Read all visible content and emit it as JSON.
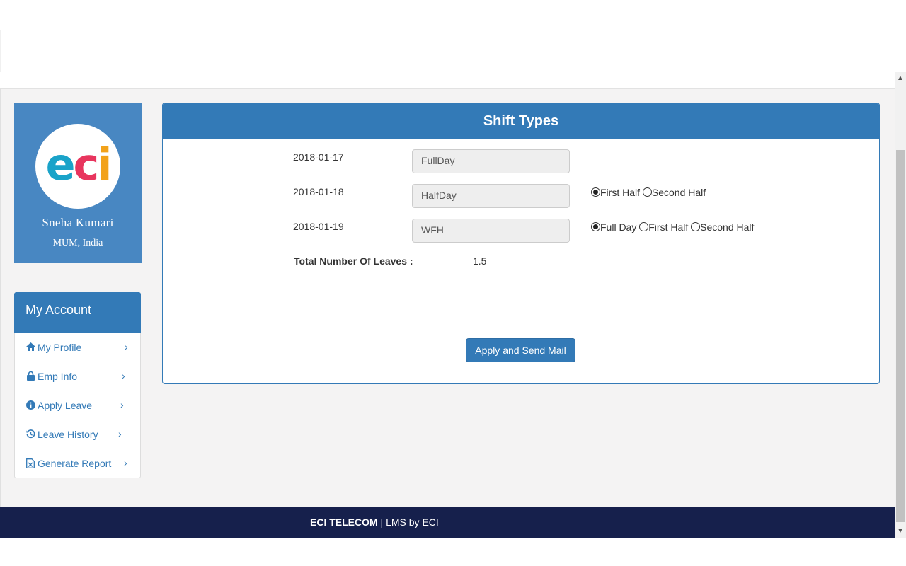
{
  "profile": {
    "name": "Sneha Kumari",
    "location": "MUM, India",
    "logo": {
      "text_e": "e",
      "text_c": "c",
      "text_i": "i"
    }
  },
  "account": {
    "title": "My Account",
    "items": [
      {
        "label": "My Profile",
        "icon": "home-icon"
      },
      {
        "label": "Emp Info",
        "icon": "lock-icon"
      },
      {
        "label": "Apply Leave",
        "icon": "info-icon"
      },
      {
        "label": "Leave History",
        "icon": "history-icon"
      },
      {
        "label": "Generate Report",
        "icon": "file-excel-icon"
      }
    ]
  },
  "shift_panel": {
    "title": "Shift Types",
    "rows": [
      {
        "date": "2018-01-17",
        "value": "FullDay",
        "options": []
      },
      {
        "date": "2018-01-18",
        "value": "HalfDay",
        "options": [
          {
            "label": "First Half",
            "checked": true
          },
          {
            "label": "Second Half",
            "checked": false
          }
        ]
      },
      {
        "date": "2018-01-19",
        "value": "WFH",
        "options": [
          {
            "label": "Full Day",
            "checked": true
          },
          {
            "label": "First Half",
            "checked": false
          },
          {
            "label": "Second Half",
            "checked": false
          }
        ]
      }
    ],
    "total_label": "Total Number Of Leaves :",
    "total_value": "1.5",
    "apply_button": "Apply and Send Mail"
  },
  "footer": {
    "company": "ECI TELECOM",
    "separator": " | ",
    "product": "LMS by ECI"
  },
  "colors": {
    "primary": "#337ab7",
    "profile_card": "#4887c2",
    "footer_bg": "#16204c"
  }
}
